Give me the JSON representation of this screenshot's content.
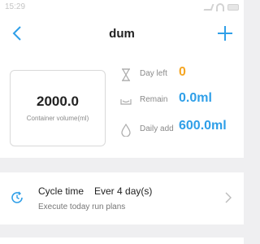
{
  "status_bar": {
    "time": "15:29"
  },
  "nav": {
    "title": "dum",
    "back_icon": "chevron-left-icon",
    "add_icon": "plus-icon"
  },
  "container": {
    "value": "2000.0",
    "label": "Container volume(ml)"
  },
  "stats": {
    "day_left": {
      "label": "Day left",
      "value": "0",
      "icon": "hourglass-icon"
    },
    "remain": {
      "label": "Remain",
      "value": "0.0ml",
      "icon": "tray-icon"
    },
    "daily_add": {
      "label": "Daily add",
      "value": "600.0ml",
      "icon": "drop-icon"
    }
  },
  "cycle": {
    "title": "Cycle time",
    "value": "Ever 4 day(s)",
    "subtitle": "Execute today run plans",
    "icon": "cycle-clock-icon"
  },
  "colors": {
    "accent": "#2f9fe8",
    "warning": "#f5a623",
    "background": "#efeff1"
  }
}
